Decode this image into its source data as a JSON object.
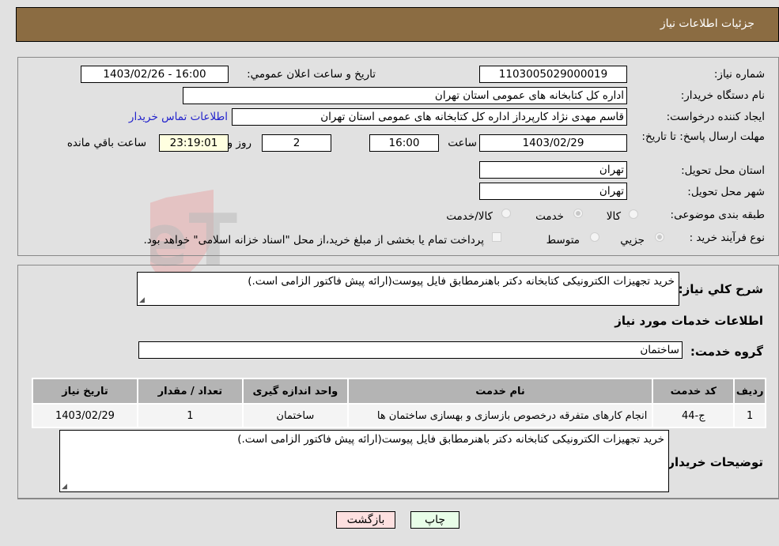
{
  "header": {
    "title": "جزئیات اطلاعات نیاز"
  },
  "form": {
    "need_number": {
      "label": "شماره نیاز:",
      "value": "1103005029000019"
    },
    "announce_datetime": {
      "label": "تاریخ و ساعت اعلان عمومي:",
      "value": "1403/02/26 - 16:00"
    },
    "buyer_org": {
      "label": "نام دستگاه خريدار:",
      "value": "اداره کل کتابخانه های عمومی استان تهران"
    },
    "requester": {
      "label": "ایجاد کننده درخواست:",
      "value": "قاسم مهدی نژاد کارپرداز اداره کل کتابخانه های عمومی استان تهران"
    },
    "buyer_contact_link": "اطلاعات تماس خریدار",
    "deadline": {
      "label": "مهلت ارسال پاسخ: تا تاریخ:",
      "date": "1403/02/29",
      "time_label": "ساعت",
      "time": "16:00",
      "days": "2",
      "days_label": "روز و",
      "remaining": "23:19:01",
      "remaining_label": "ساعت باقي مانده"
    },
    "province": {
      "label": "استان محل تحویل:",
      "value": "تهران"
    },
    "city": {
      "label": "شهر محل تحویل:",
      "value": "تهران"
    },
    "category": {
      "label": "طبقه بندی موضوعی:",
      "options": [
        {
          "label": "کالا",
          "checked": false
        },
        {
          "label": "خدمت",
          "checked": true
        },
        {
          "label": "کالا/خدمت",
          "checked": false
        }
      ]
    },
    "process": {
      "label": "نوع فرآیند خرید :",
      "options": [
        {
          "label": "جزيي",
          "checked": true
        },
        {
          "label": "متوسط",
          "checked": false
        }
      ],
      "treasury_note": "پرداخت تمام یا بخشی از مبلغ خرید،از محل \"اسناد خزانه اسلامی\" خواهد بود."
    }
  },
  "details": {
    "description_label": "شرح کلي نياز:",
    "description": "خرید تجهیزات الکترونیکی کتابخانه دکتر باهنرمطابق فایل پیوست(ارائه پیش فاکتور الزامی است.)",
    "services_heading": "اطلاعات خدمات مورد نياز",
    "service_group_label": "گروه خدمت:",
    "service_group": "ساختمان",
    "table": {
      "headers": [
        "ردیف",
        "کد خدمت",
        "نام خدمت",
        "واحد اندازه گیری",
        "تعداد / مقدار",
        "تاریخ نیاز"
      ],
      "rows": [
        [
          "1",
          "ج-44",
          "انجام کارهای متفرقه درخصوص بازسازی و بهسازی ساختمان ها",
          "ساختمان",
          "1",
          "1403/02/29"
        ]
      ]
    },
    "buyer_notes_label": "توضیحات خریدار:",
    "buyer_notes": "خرید تجهیزات الکترونیکی کتابخانه دکتر باهنرمطابق فایل پیوست(ارائه پیش فاکتور الزامی است.)"
  },
  "buttons": {
    "print": "چاپ",
    "back": "بازگشت"
  },
  "watermark": "AriaTender.neT",
  "colors": {
    "header_bg": "#8b6c42",
    "print_bg": "#e8fde8",
    "back_bg": "#fde0e0",
    "link": "#2222cc"
  }
}
